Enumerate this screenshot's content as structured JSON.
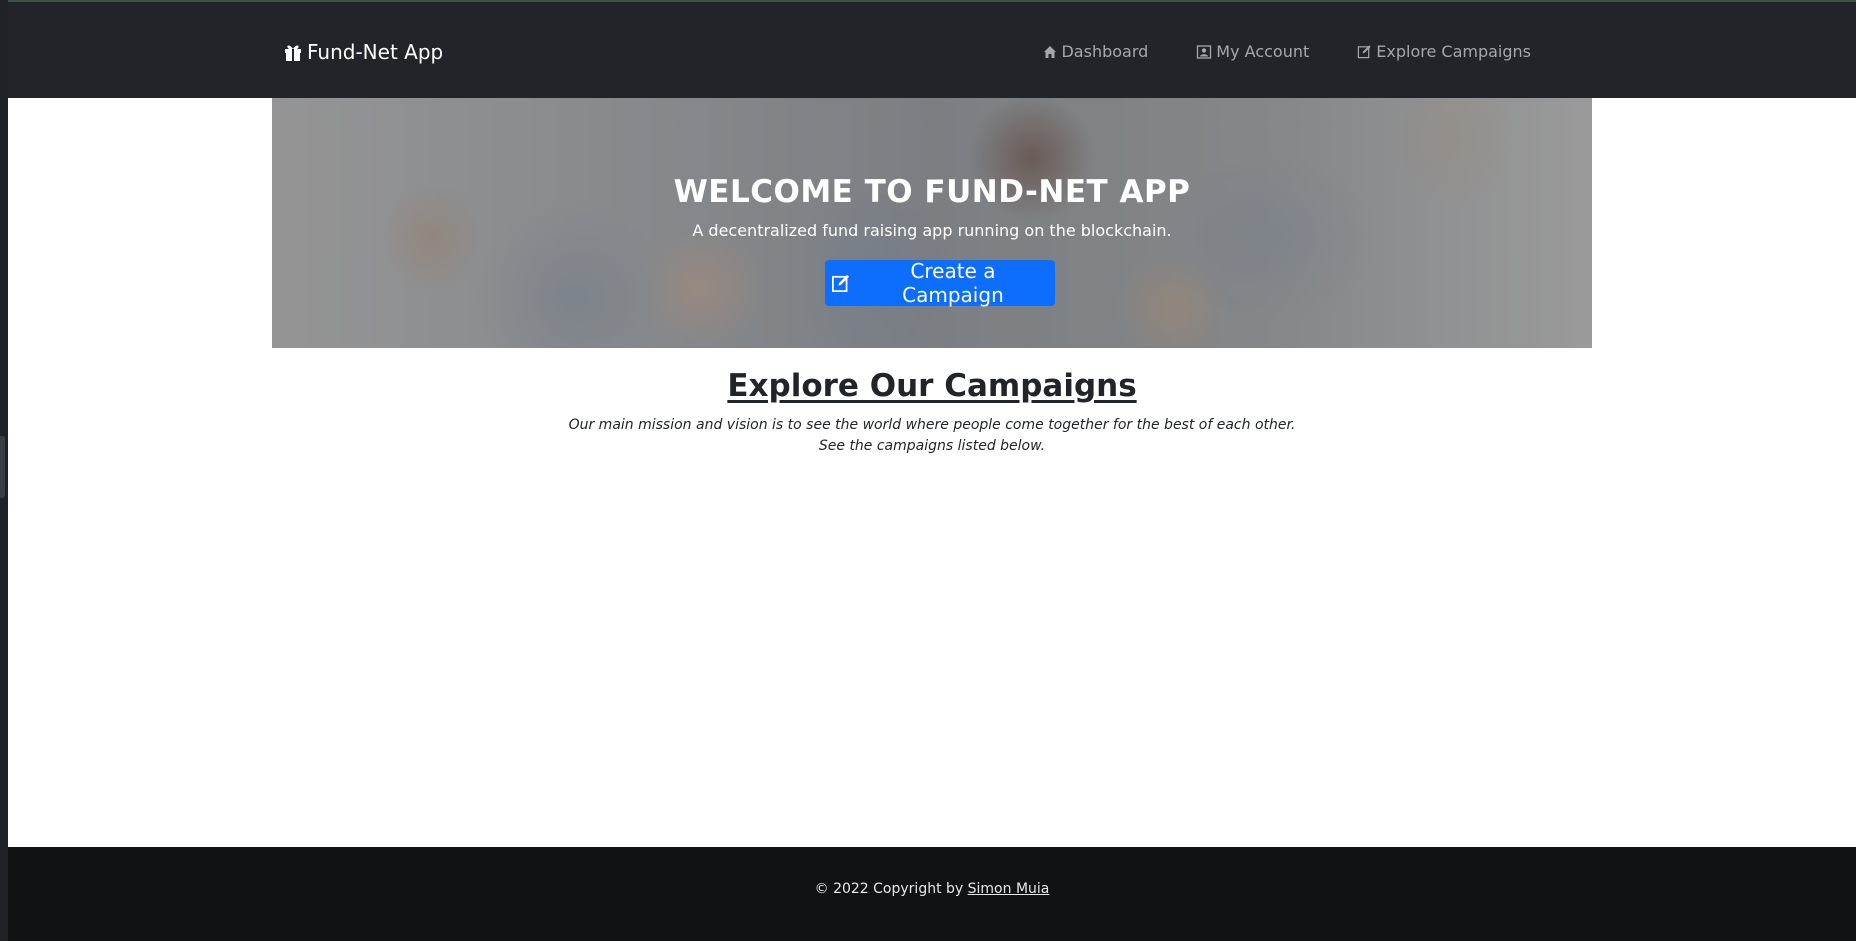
{
  "navbar": {
    "brand": {
      "label": "Fund-Net App",
      "icon": "gift-icon"
    },
    "links": [
      {
        "label": "Dashboard",
        "icon": "home-icon"
      },
      {
        "label": "My Account",
        "icon": "user-badge-icon"
      },
      {
        "label": "Explore Campaigns",
        "icon": "edit-icon"
      }
    ]
  },
  "hero": {
    "title": "WELCOME TO FUND-NET APP",
    "subtitle": "A decentralized fund raising app running on the blockchain.",
    "button": {
      "label": "Create a Campaign",
      "icon": "edit-icon"
    }
  },
  "explore": {
    "title": "Explore Our Campaigns",
    "line1": "Our main mission and vision is to see the world where people come together for the best of each other.",
    "line2": "See the campaigns listed below."
  },
  "footer": {
    "copyright": "© 2022 Copyright by",
    "author": "Simon Muia"
  },
  "colors": {
    "navbar_bg": "#212529",
    "primary_button": "#0d6efd",
    "footer_bg": "#111213"
  }
}
